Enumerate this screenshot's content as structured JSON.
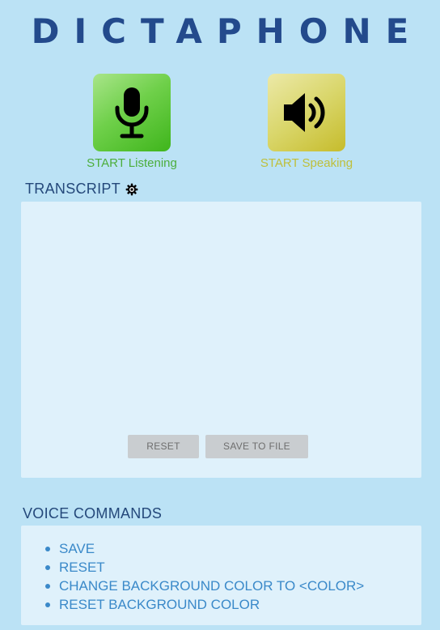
{
  "app": {
    "title": "DICTAPHONE"
  },
  "controls": {
    "listen": {
      "label": "START Listening",
      "icon": "microphone-icon",
      "color": "#5bc43a"
    },
    "speak": {
      "label": "START Speaking",
      "icon": "speaker-icon",
      "color": "#d0c947"
    }
  },
  "transcript": {
    "title": "TRANSCRIPT",
    "settings_icon": "gear-icon",
    "text": "",
    "reset_label": "RESET",
    "save_label": "SAVE TO FILE"
  },
  "voice_commands": {
    "title": "VOICE COMMANDS",
    "items": [
      "SAVE",
      "RESET",
      "CHANGE BACKGROUND COLOR TO <COLOR>",
      "RESET BACKGROUND COLOR"
    ]
  },
  "colors": {
    "background": "#bbe2f5",
    "panel": "#dff1fb",
    "title": "#234a8c",
    "command_text": "#3a89c9"
  }
}
